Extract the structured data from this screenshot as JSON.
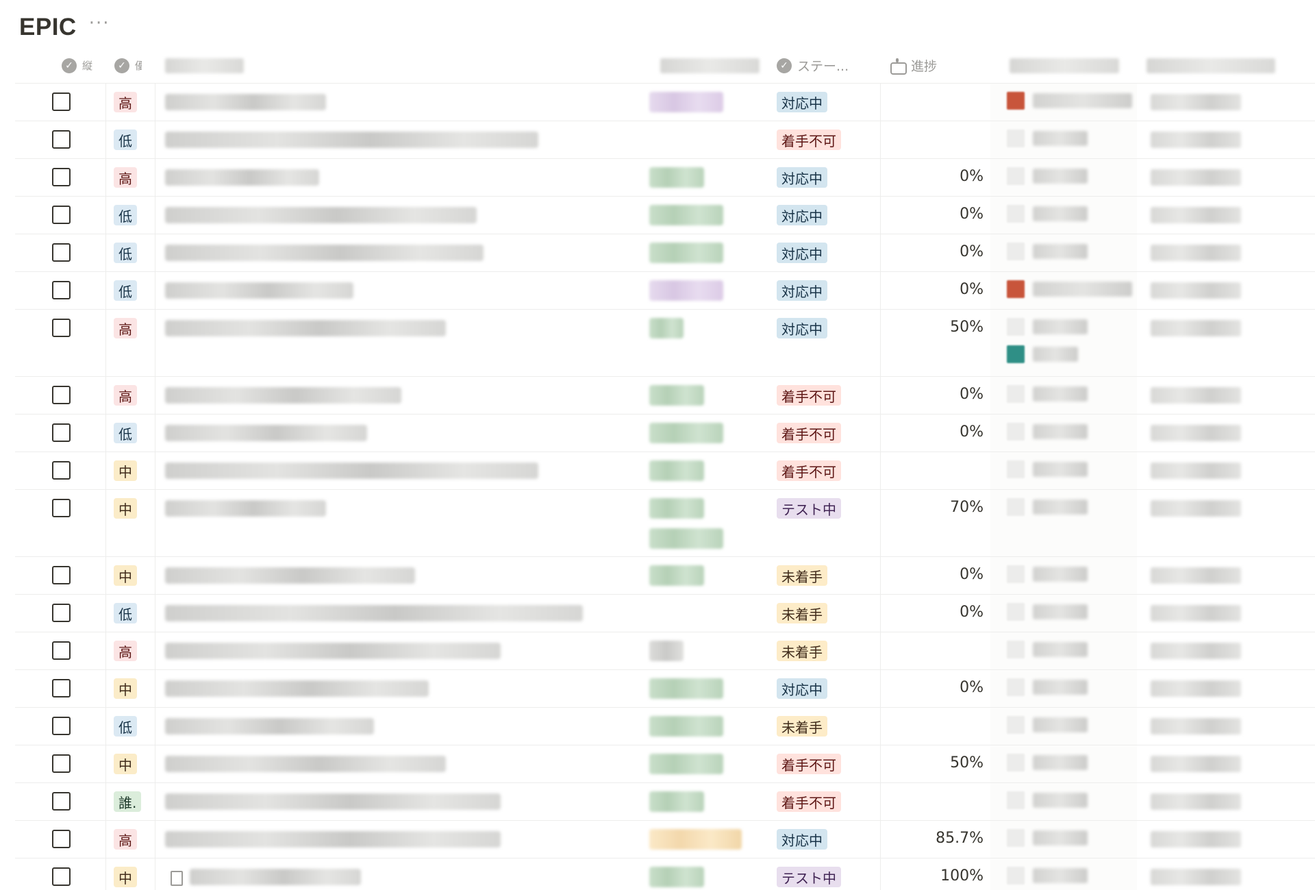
{
  "page": {
    "title": "EPIC",
    "more_label": "···"
  },
  "columns": {
    "check": "縦",
    "priority": "優",
    "status": "ステー...",
    "progress": "進捗"
  },
  "rows": [
    {
      "priority": "高",
      "priority_kind": "high",
      "status": "対応中",
      "status_kind": "doing",
      "progress": "",
      "name_w": 235,
      "tag": "purple",
      "tag_w": 108,
      "rel": "red"
    },
    {
      "priority": "低",
      "priority_kind": "low",
      "status": "着手不可",
      "status_kind": "blocked",
      "progress": "",
      "name_w": 545,
      "tag": "",
      "tag_w": 0,
      "rel": ""
    },
    {
      "priority": "高",
      "priority_kind": "high",
      "status": "対応中",
      "status_kind": "doing",
      "progress": "0%",
      "name_w": 225,
      "tag": "green",
      "tag_w": 80,
      "rel": ""
    },
    {
      "priority": "低",
      "priority_kind": "low",
      "status": "対応中",
      "status_kind": "doing",
      "progress": "0%",
      "name_w": 455,
      "tag": "green",
      "tag_w": 108,
      "rel": ""
    },
    {
      "priority": "低",
      "priority_kind": "low",
      "status": "対応中",
      "status_kind": "doing",
      "progress": "0%",
      "name_w": 465,
      "tag": "green",
      "tag_w": 108,
      "rel": ""
    },
    {
      "priority": "低",
      "priority_kind": "low",
      "status": "対応中",
      "status_kind": "doing",
      "progress": "0%",
      "name_w": 275,
      "tag": "purple",
      "tag_w": 108,
      "rel": "red"
    },
    {
      "priority": "高",
      "priority_kind": "high",
      "status": "対応中",
      "status_kind": "doing",
      "progress": "50%",
      "name_w": 410,
      "tag": "green",
      "tag_w": 50,
      "rel": "teal",
      "tall": true
    },
    {
      "priority": "高",
      "priority_kind": "high",
      "status": "着手不可",
      "status_kind": "blocked",
      "progress": "0%",
      "name_w": 345,
      "tag": "green",
      "tag_w": 80,
      "rel": ""
    },
    {
      "priority": "低",
      "priority_kind": "low",
      "status": "着手不可",
      "status_kind": "blocked",
      "progress": "0%",
      "name_w": 295,
      "tag": "green",
      "tag_w": 108,
      "rel": ""
    },
    {
      "priority": "中",
      "priority_kind": "mid",
      "status": "着手不可",
      "status_kind": "blocked",
      "progress": "",
      "name_w": 545,
      "tag": "green",
      "tag_w": 80,
      "rel": ""
    },
    {
      "priority": "中",
      "priority_kind": "mid",
      "status": "テスト中",
      "status_kind": "test",
      "progress": "70%",
      "name_w": 235,
      "tag": "green",
      "tag_w": 80,
      "rel": "",
      "tall": true,
      "tag2_w": 108
    },
    {
      "priority": "中",
      "priority_kind": "mid",
      "status": "未着手",
      "status_kind": "todo",
      "progress": "0%",
      "name_w": 365,
      "tag": "green",
      "tag_w": 80,
      "rel": ""
    },
    {
      "priority": "低",
      "priority_kind": "low",
      "status": "未着手",
      "status_kind": "todo",
      "progress": "0%",
      "name_w": 610,
      "tag": "",
      "tag_w": 0,
      "rel": ""
    },
    {
      "priority": "高",
      "priority_kind": "high",
      "status": "未着手",
      "status_kind": "todo",
      "progress": "",
      "name_w": 490,
      "tag": "gray",
      "tag_w": 50,
      "rel": ""
    },
    {
      "priority": "中",
      "priority_kind": "mid",
      "status": "対応中",
      "status_kind": "doing",
      "progress": "0%",
      "name_w": 385,
      "tag": "green",
      "tag_w": 108,
      "rel": ""
    },
    {
      "priority": "低",
      "priority_kind": "low",
      "status": "未着手",
      "status_kind": "todo",
      "progress": "",
      "name_w": 305,
      "tag": "green",
      "tag_w": 108,
      "rel": ""
    },
    {
      "priority": "中",
      "priority_kind": "mid",
      "status": "着手不可",
      "status_kind": "blocked",
      "progress": "50%",
      "name_w": 410,
      "tag": "green",
      "tag_w": 108,
      "rel": ""
    },
    {
      "priority": "誰.",
      "priority_kind": "who",
      "status": "着手不可",
      "status_kind": "blocked",
      "progress": "",
      "name_w": 490,
      "tag": "green",
      "tag_w": 80,
      "rel": ""
    },
    {
      "priority": "高",
      "priority_kind": "high",
      "status": "対応中",
      "status_kind": "doing",
      "progress": "85.7%",
      "name_w": 490,
      "tag": "yellow",
      "tag_w": 135,
      "rel": ""
    },
    {
      "priority": "中",
      "priority_kind": "mid",
      "status": "テスト中",
      "status_kind": "test",
      "progress": "100%",
      "name_w": 250,
      "tag": "green",
      "tag_w": 80,
      "rel": "",
      "doc": true
    }
  ]
}
